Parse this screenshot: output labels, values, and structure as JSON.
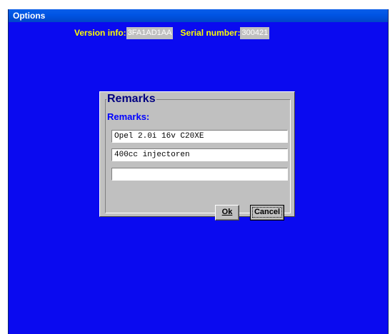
{
  "window": {
    "title": "Options"
  },
  "info": {
    "version_label": "Version info:",
    "version_value": "3FA1AD1AA",
    "serial_label": "Serial number:",
    "serial_value": "300421"
  },
  "dialog": {
    "group_title": "Remarks",
    "sub_label": "Remarks:",
    "fields": [
      {
        "value": "Opel 2.0i 16v C20XE"
      },
      {
        "value": "400cc injectoren"
      },
      {
        "value": ""
      }
    ],
    "ok_label": "Ok",
    "cancel_label": "Cancel"
  },
  "colors": {
    "window_background": "#0a0af0",
    "info_label": "#ffff00",
    "sub_label": "#0000ff",
    "group_title": "#000080"
  }
}
